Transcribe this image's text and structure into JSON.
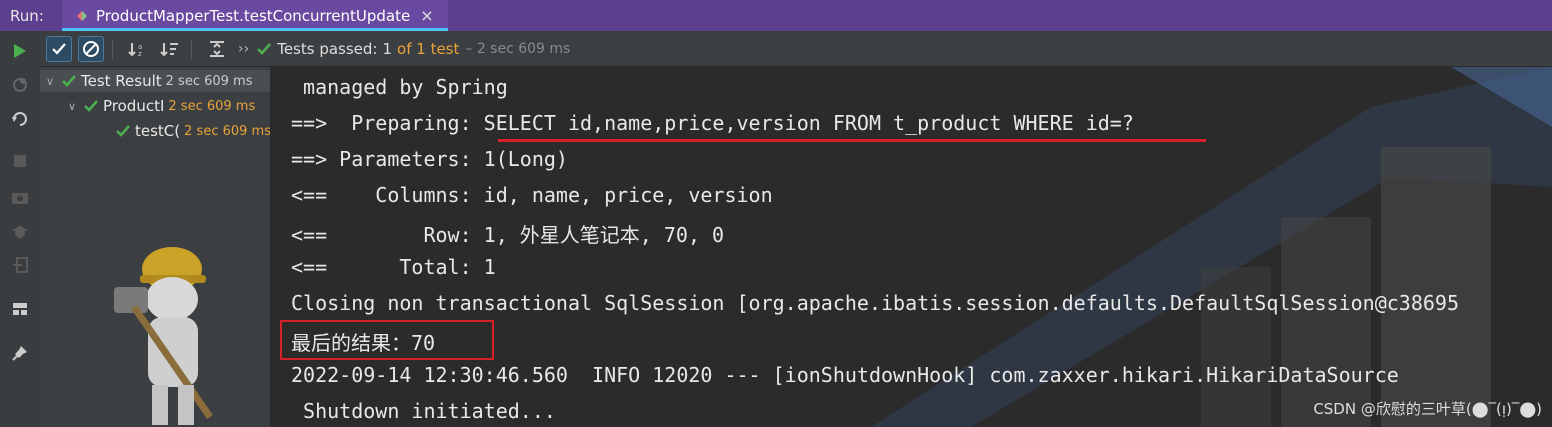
{
  "run_bar": {
    "label": "Run:",
    "tab_title": "ProductMapperTest.testConcurrentUpdate",
    "close": "×"
  },
  "test_toolbar": {
    "chevron": "››",
    "passed_label": "Tests passed:",
    "passed_count": "1",
    "of_total": "of 1 test",
    "duration": "– 2 sec 609 ms"
  },
  "tree": {
    "items": [
      {
        "name": "Test Result",
        "time": "2 sec 609 ms"
      },
      {
        "name": "ProductI",
        "time": "2 sec 609 ms"
      },
      {
        "name": "testC(",
        "time": "2 sec 609 ms"
      }
    ]
  },
  "console": {
    "lines": [
      " managed by Spring",
      "==>  Preparing: SELECT id,name,price,version FROM t_product WHERE id=?",
      "==> Parameters: 1(Long)",
      "<==    Columns: id, name, price, version",
      "<==        Row: 1, 外星人笔记本, 70, 0",
      "<==      Total: 1",
      "Closing non transactional SqlSession [org.apache.ibatis.session.defaults.DefaultSqlSession@c38695",
      "最后的结果：70",
      "2022-09-14 12:30:46.560  INFO 12020 --- [ionShutdownHook] com.zaxxer.hikari.HikariDataSource",
      " Shutdown initiated..."
    ]
  },
  "watermark": "CSDN @欣慰的三叶草(⬤‾(ᴉ)‾⬤)",
  "colors": {
    "accent_purple": "#5d3f8f",
    "pass_green": "#4caf50",
    "orange": "#e8a33a",
    "annotation_red": "#d6212b"
  }
}
